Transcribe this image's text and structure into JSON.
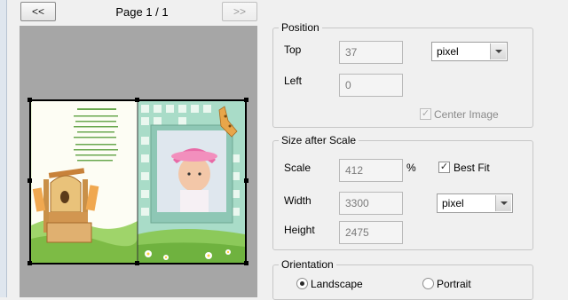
{
  "nav": {
    "prev_label": "<<",
    "next_label": ">>",
    "page_indicator": "Page 1 / 1"
  },
  "position": {
    "title": "Position",
    "top_label": "Top",
    "top_value": "37",
    "left_label": "Left",
    "left_value": "0",
    "unit": "pixel",
    "center_image_label": "Center Image",
    "center_image_checked": true
  },
  "size_after_scale": {
    "title": "Size after Scale",
    "scale_label": "Scale",
    "scale_value": "412",
    "scale_unit": "%",
    "best_fit_label": "Best Fit",
    "best_fit_checked": true,
    "width_label": "Width",
    "width_value": "3300",
    "height_label": "Height",
    "height_value": "2475",
    "unit": "pixel"
  },
  "orientation": {
    "title": "Orientation",
    "landscape_label": "Landscape",
    "portrait_label": "Portrait",
    "selected": "Landscape"
  },
  "colors": {
    "preview_bg": "#a6a6a6",
    "page_mint": "#a9dcc8",
    "grass": "#8cc95a"
  }
}
